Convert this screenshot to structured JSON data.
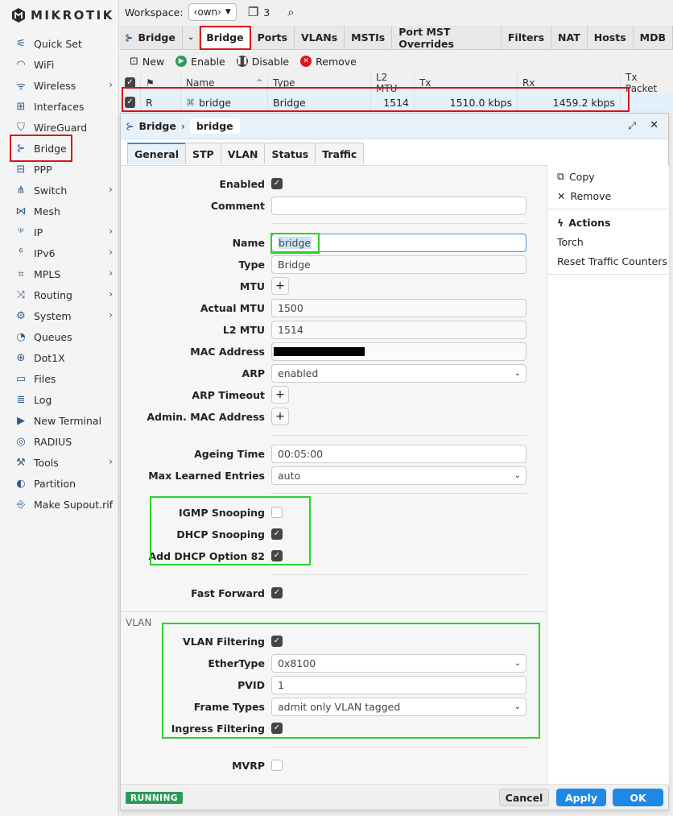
{
  "app": {
    "logo_text": "MikroTik"
  },
  "sidebar": {
    "items": [
      {
        "label": "Quick Set",
        "icon": "wand-icon",
        "has_sub": false
      },
      {
        "label": "WiFi",
        "icon": "wifi-icon",
        "has_sub": false
      },
      {
        "label": "Wireless",
        "icon": "wireless-icon",
        "has_sub": true
      },
      {
        "label": "Interfaces",
        "icon": "interfaces-icon",
        "has_sub": false
      },
      {
        "label": "WireGuard",
        "icon": "shield-icon",
        "has_sub": false
      },
      {
        "label": "Bridge",
        "icon": "bridge-icon",
        "has_sub": false
      },
      {
        "label": "PPP",
        "icon": "ppp-icon",
        "has_sub": false
      },
      {
        "label": "Switch",
        "icon": "switch-icon",
        "has_sub": true
      },
      {
        "label": "Mesh",
        "icon": "mesh-icon",
        "has_sub": false
      },
      {
        "label": "IP",
        "icon": "ip-icon",
        "has_sub": true
      },
      {
        "label": "IPv6",
        "icon": "ipv6-icon",
        "has_sub": true
      },
      {
        "label": "MPLS",
        "icon": "tag-icon",
        "has_sub": true
      },
      {
        "label": "Routing",
        "icon": "routing-icon",
        "has_sub": true
      },
      {
        "label": "System",
        "icon": "gear-icon",
        "has_sub": true
      },
      {
        "label": "Queues",
        "icon": "queues-icon",
        "has_sub": false
      },
      {
        "label": "Dot1X",
        "icon": "dot1x-icon",
        "has_sub": false
      },
      {
        "label": "Files",
        "icon": "folder-icon",
        "has_sub": false
      },
      {
        "label": "Log",
        "icon": "log-icon",
        "has_sub": false
      },
      {
        "label": "New Terminal",
        "icon": "terminal-icon",
        "has_sub": false
      },
      {
        "label": "RADIUS",
        "icon": "radius-icon",
        "has_sub": false
      },
      {
        "label": "Tools",
        "icon": "tools-icon",
        "has_sub": true
      },
      {
        "label": "Partition",
        "icon": "partition-icon",
        "has_sub": false
      },
      {
        "label": "Make Supout.rif",
        "icon": "supout-icon",
        "has_sub": false
      }
    ]
  },
  "topbar": {
    "workspace_label": "Workspace:",
    "workspace_value": "‹own›",
    "windows_count": "3"
  },
  "tabbar": {
    "tabs": [
      "Bridge",
      "Ports",
      "VLANs",
      "MSTIs",
      "Port MST Overrides",
      "Filters",
      "NAT",
      "Hosts",
      "MDB"
    ],
    "title": "Bridge"
  },
  "actions": {
    "new": "New",
    "enable": "Enable",
    "disable": "Disable",
    "remove": "Remove"
  },
  "table": {
    "columns": [
      "Name",
      "Type",
      "L2 MTU",
      "Tx",
      "Rx",
      "Tx Packet"
    ],
    "row": {
      "flag": "R",
      "name": "bridge",
      "type": "Bridge",
      "l2mtu": "1514",
      "tx": "1510.0 kbps",
      "rx": "1459.2 kbps"
    }
  },
  "dialog": {
    "crumb_root": "Bridge",
    "crumb_item": "bridge",
    "tabs": [
      "General",
      "STP",
      "VLAN",
      "Status",
      "Traffic"
    ],
    "fields": {
      "enabled": "Enabled",
      "comment": "Comment",
      "name": "Name",
      "name_value": "bridge",
      "type": "Type",
      "type_value": "Bridge",
      "mtu": "MTU",
      "actual_mtu": "Actual MTU",
      "actual_mtu_value": "1500",
      "l2mtu": "L2 MTU",
      "l2mtu_value": "1514",
      "mac": "MAC Address",
      "arp": "ARP",
      "arp_value": "enabled",
      "arp_timeout": "ARP Timeout",
      "admin_mac": "Admin. MAC Address",
      "ageing": "Ageing Time",
      "ageing_value": "00:05:00",
      "max_learned": "Max Learned Entries",
      "max_learned_value": "auto",
      "igmp": "IGMP Snooping",
      "dhcp": "DHCP Snooping",
      "opt82": "Add DHCP Option 82",
      "fast_forward": "Fast Forward",
      "vlan_section": "VLAN",
      "vlan_filtering": "VLAN Filtering",
      "ethertype": "EtherType",
      "ethertype_value": "0x8100",
      "pvid": "PVID",
      "pvid_value": "1",
      "frame_types": "Frame Types",
      "frame_types_value": "admit only VLAN tagged",
      "ingress": "Ingress Filtering",
      "mvrp": "MVRP"
    },
    "side": {
      "copy": "Copy",
      "remove": "Remove",
      "actions": "Actions",
      "torch": "Torch",
      "reset": "Reset Traffic Counters"
    },
    "footer": {
      "status": "RUNNING",
      "cancel": "Cancel",
      "apply": "Apply",
      "ok": "OK"
    }
  },
  "colors": {
    "accent": "#1e88e5",
    "highlight_red": "#d9141c",
    "highlight_green": "#2ed12e",
    "running": "#2b9b56"
  }
}
